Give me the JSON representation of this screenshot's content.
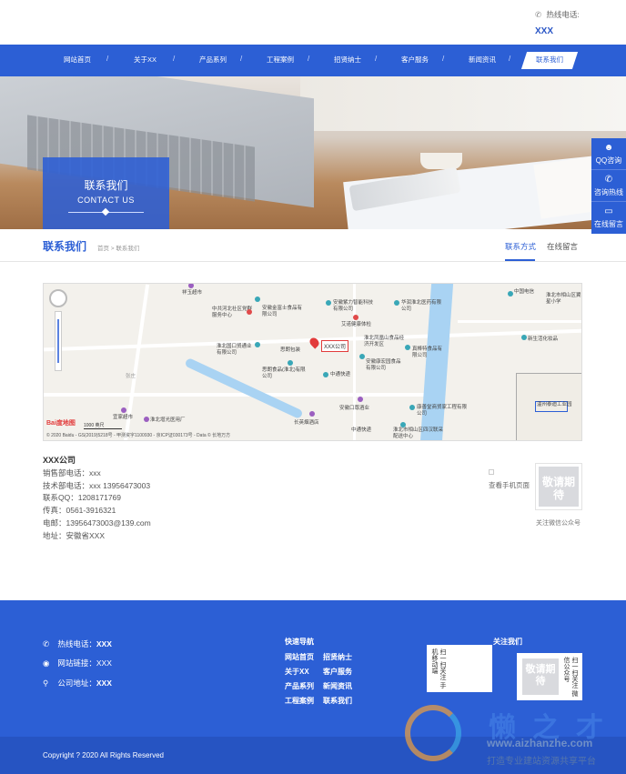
{
  "header": {
    "hotline_label": "热线电话:",
    "hotline_number": "XXX",
    "phone_icon": "phone-icon"
  },
  "nav": {
    "items": [
      "网站首页",
      "关于XX",
      "产品系列",
      "工程案例",
      "招贤纳士",
      "客户服务",
      "新闻资讯",
      "联系我们"
    ],
    "active": "联系我们",
    "separator": "/"
  },
  "banner": {
    "title": "联系我们",
    "subtitle": "CONTACT US"
  },
  "side": {
    "items": [
      {
        "icon": "qq-icon",
        "label": "QQ咨询"
      },
      {
        "icon": "hotline-icon",
        "label": "咨询热线"
      },
      {
        "icon": "message-icon",
        "label": "在线留言"
      }
    ]
  },
  "section": {
    "title": "联系我们",
    "breadcrumb": "首页 > 联系我们",
    "tabs": [
      "联系方式",
      "在线留言"
    ],
    "active_tab": "联系方式"
  },
  "map": {
    "marker_label": "XXX公司",
    "pois": [
      "中国电信",
      "淮北市相山区翼星小学",
      "祥玉超市",
      "中共河北社区党群服务中心",
      "安徽金富士食品有限公司",
      "安徽紫力智能科技有限公司",
      "华润淮北医药有限公司",
      "艾诺健康体检",
      "淮北国口贸通业有限公司",
      "思朗包装",
      "淮北凤凰山食品经济开发区",
      "真棒特食品有限公司",
      "思朗食品(淮北)有限公司",
      "安徽康宏园食品有限公司",
      "中通快递",
      "新生活化妆品",
      "张庄",
      "宜家超市",
      "淮北增光医用厂",
      "安徽口尊酒业",
      "长英烟酒店",
      "康善堂商贸家工程有限公司",
      "淮北市相山区四汉联采配送中心",
      "中通快递"
    ],
    "copyright": "© 2020 Baidu - GS(2019)5218号 - 甲测资字1100930 - 京ICP证030173号 - Data © 长地万方",
    "scale": "1000 英尺",
    "logo": "Bai度地图",
    "mini_label": "温州泰迪工业园"
  },
  "contact": {
    "company": "XXX公司",
    "lines": [
      "销售部电话：xxx",
      "技术部电话：xxx  13956473003",
      "联系QQ：1208171769",
      "传真：0561-3916321",
      "电邮：13956473003@139.com",
      "地址：安徽省XXX"
    ],
    "mobile_label": "查看手机页面",
    "wx_placeholder": "敬请期待",
    "wx_label": "关注微信公众号"
  },
  "footer": {
    "rows": [
      {
        "icon": "phone-icon",
        "label": "热线电话：",
        "value": "XXX"
      },
      {
        "icon": "globe-icon",
        "label": "网站链接：",
        "value": "XXX"
      },
      {
        "icon": "location-icon",
        "label": "公司地址：",
        "value": "XXX"
      }
    ],
    "quick_title": "快速导航",
    "links": [
      "网站首页",
      "招贤纳士",
      "关于XX",
      "客户服务",
      "产品系列",
      "新闻资讯",
      "工程案例",
      "联系我们"
    ],
    "follow_title": "关注我们",
    "qr1_text": "扫一扫关注 手机移动端",
    "qr2_text": "扫一扫关注 微信公众号",
    "qr2_placeholder": "敬请期待",
    "copyright": "Copyright ? 2020 All Rights Reserved"
  },
  "watermark": {
    "brand": "懒之才",
    "url": "www.aizhanzhe.com",
    "slogan": "打造专业建站资源共享平台"
  },
  "colors": {
    "primary": "#2c5fd5",
    "footer_bottom": "#2654c2",
    "marker": "#e23b3b"
  }
}
